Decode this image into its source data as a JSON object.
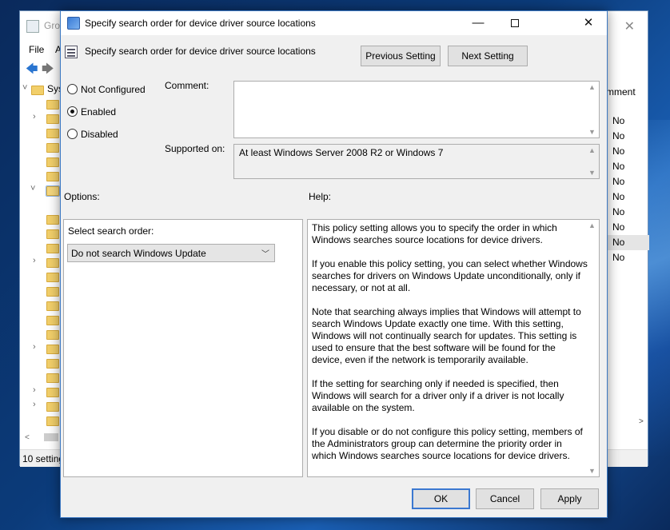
{
  "background_window": {
    "title": "Gro",
    "menu": [
      "File",
      "A"
    ],
    "tree_label": "Sys",
    "column_header": "mment",
    "column_values": [
      "No",
      "No",
      "No",
      "No",
      "No",
      "No",
      "No",
      "No",
      "No",
      "No"
    ],
    "status": "10 setting"
  },
  "dialog": {
    "title": "Specify search order for device driver source locations",
    "header": "Specify search order for device driver source locations",
    "previous_button": "Previous Setting",
    "next_button": "Next Setting",
    "state_options": [
      {
        "label": "Not Configured",
        "checked": false
      },
      {
        "label": "Enabled",
        "checked": true
      },
      {
        "label": "Disabled",
        "checked": false
      }
    ],
    "comment_label": "Comment:",
    "comment_value": "",
    "supported_label": "Supported on:",
    "supported_value": "At least Windows Server 2008 R2 or Windows 7",
    "options_label": "Options:",
    "help_label": "Help:",
    "select_label": "Select search order:",
    "select_value": "Do not search Windows Update",
    "help_paragraphs": [
      "This policy setting allows you to specify the order in which Windows searches source locations for device drivers.",
      "If you enable this policy setting, you can select whether Windows searches for drivers on Windows Update unconditionally, only if necessary, or not at all.",
      "Note that searching always implies that Windows will attempt to search Windows Update exactly one time. With this setting, Windows will not continually search for updates. This setting is used to ensure that the best software will be found for the device, even if the network is temporarily available.",
      "If the setting for searching only if needed is specified, then Windows will search for a driver only if a driver is not locally available on the system.",
      "If you disable or do not configure this policy setting, members of the Administrators group can determine the priority order in which Windows searches source locations for device drivers."
    ],
    "ok_button": "OK",
    "cancel_button": "Cancel",
    "apply_button": "Apply"
  }
}
